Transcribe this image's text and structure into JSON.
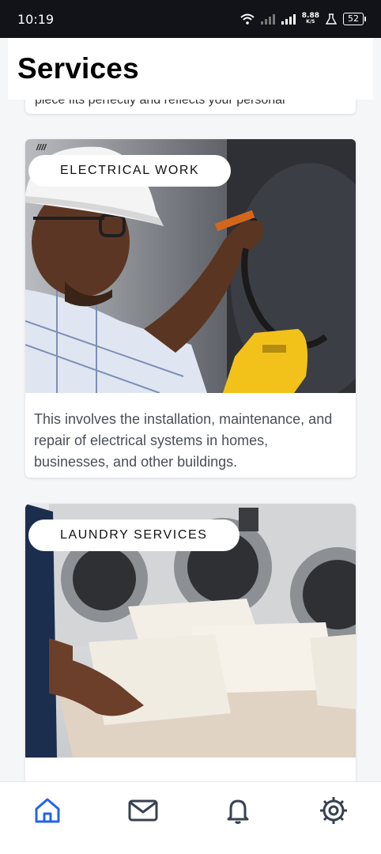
{
  "status_bar": {
    "time": "10:19",
    "net_speed_value": "8.88",
    "net_speed_unit": "K/S",
    "battery": "52"
  },
  "header": {
    "title": "Services"
  },
  "prev_card": {
    "description_fragment": "piece fits perfectly and reflects your personal"
  },
  "services": [
    {
      "tag": "ELECTRICAL WORK",
      "description": "This involves the installation, maintenance, and repair of electrical systems in homes, businesses, and other buildings.",
      "image_icon": "electrician-photo"
    },
    {
      "tag": "LAUNDRY SERVICES",
      "description": "",
      "image_icon": "laundry-photo"
    }
  ],
  "bottom_nav": {
    "active_color": "#2563eb",
    "inactive_color": "#374151",
    "items": [
      {
        "icon": "home-icon",
        "active": true
      },
      {
        "icon": "mail-icon",
        "active": false
      },
      {
        "icon": "bell-icon",
        "active": false
      },
      {
        "icon": "settings-icon",
        "active": false
      }
    ]
  }
}
